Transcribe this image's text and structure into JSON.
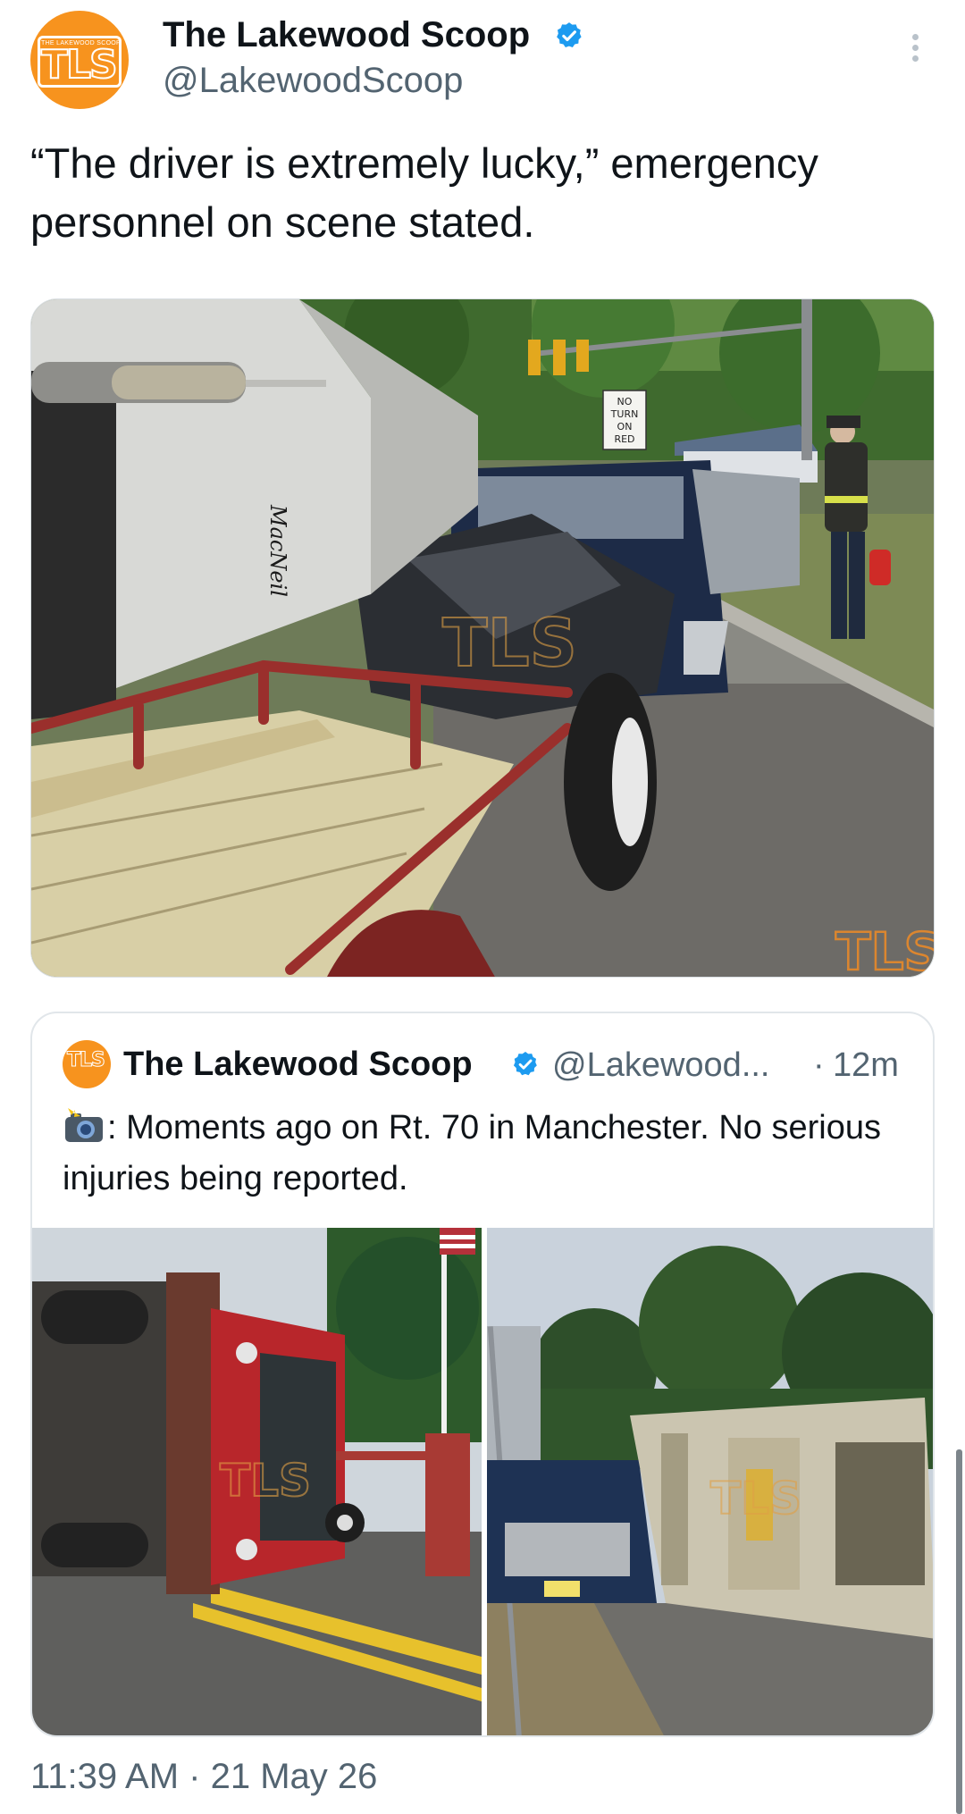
{
  "author": {
    "display_name": "The Lakewood Scoop",
    "handle": "@LakewoodScoop",
    "avatar_letters": "TLS",
    "avatar_small_text": "THE LAKEWOOD SCOOP",
    "verified": true,
    "brand_color": "#f7931e",
    "verified_color": "#1d9bf0"
  },
  "tweet": {
    "text": "“The driver is extremely lucky,” emergency personnel on scene stated.",
    "timestamp": "11:39 AM · 21 May 26"
  },
  "main_image": {
    "sign_lines": [
      "NO",
      "TURN",
      "ON",
      "RED"
    ],
    "trailer_script": "MacNeil",
    "watermark": "TLS"
  },
  "quoted_tweet": {
    "display_name": "The Lakewood Scoop",
    "handle": "@Lakewood...",
    "separator": "·",
    "time": "12m",
    "camera_icon": "camera-flash-icon",
    "text": ": Moments ago on Rt. 70 in Manchester. No serious injuries being reported.",
    "watermark": "TLS"
  },
  "icons": {
    "verified": "verified-badge-icon",
    "more": "more-options-icon"
  }
}
